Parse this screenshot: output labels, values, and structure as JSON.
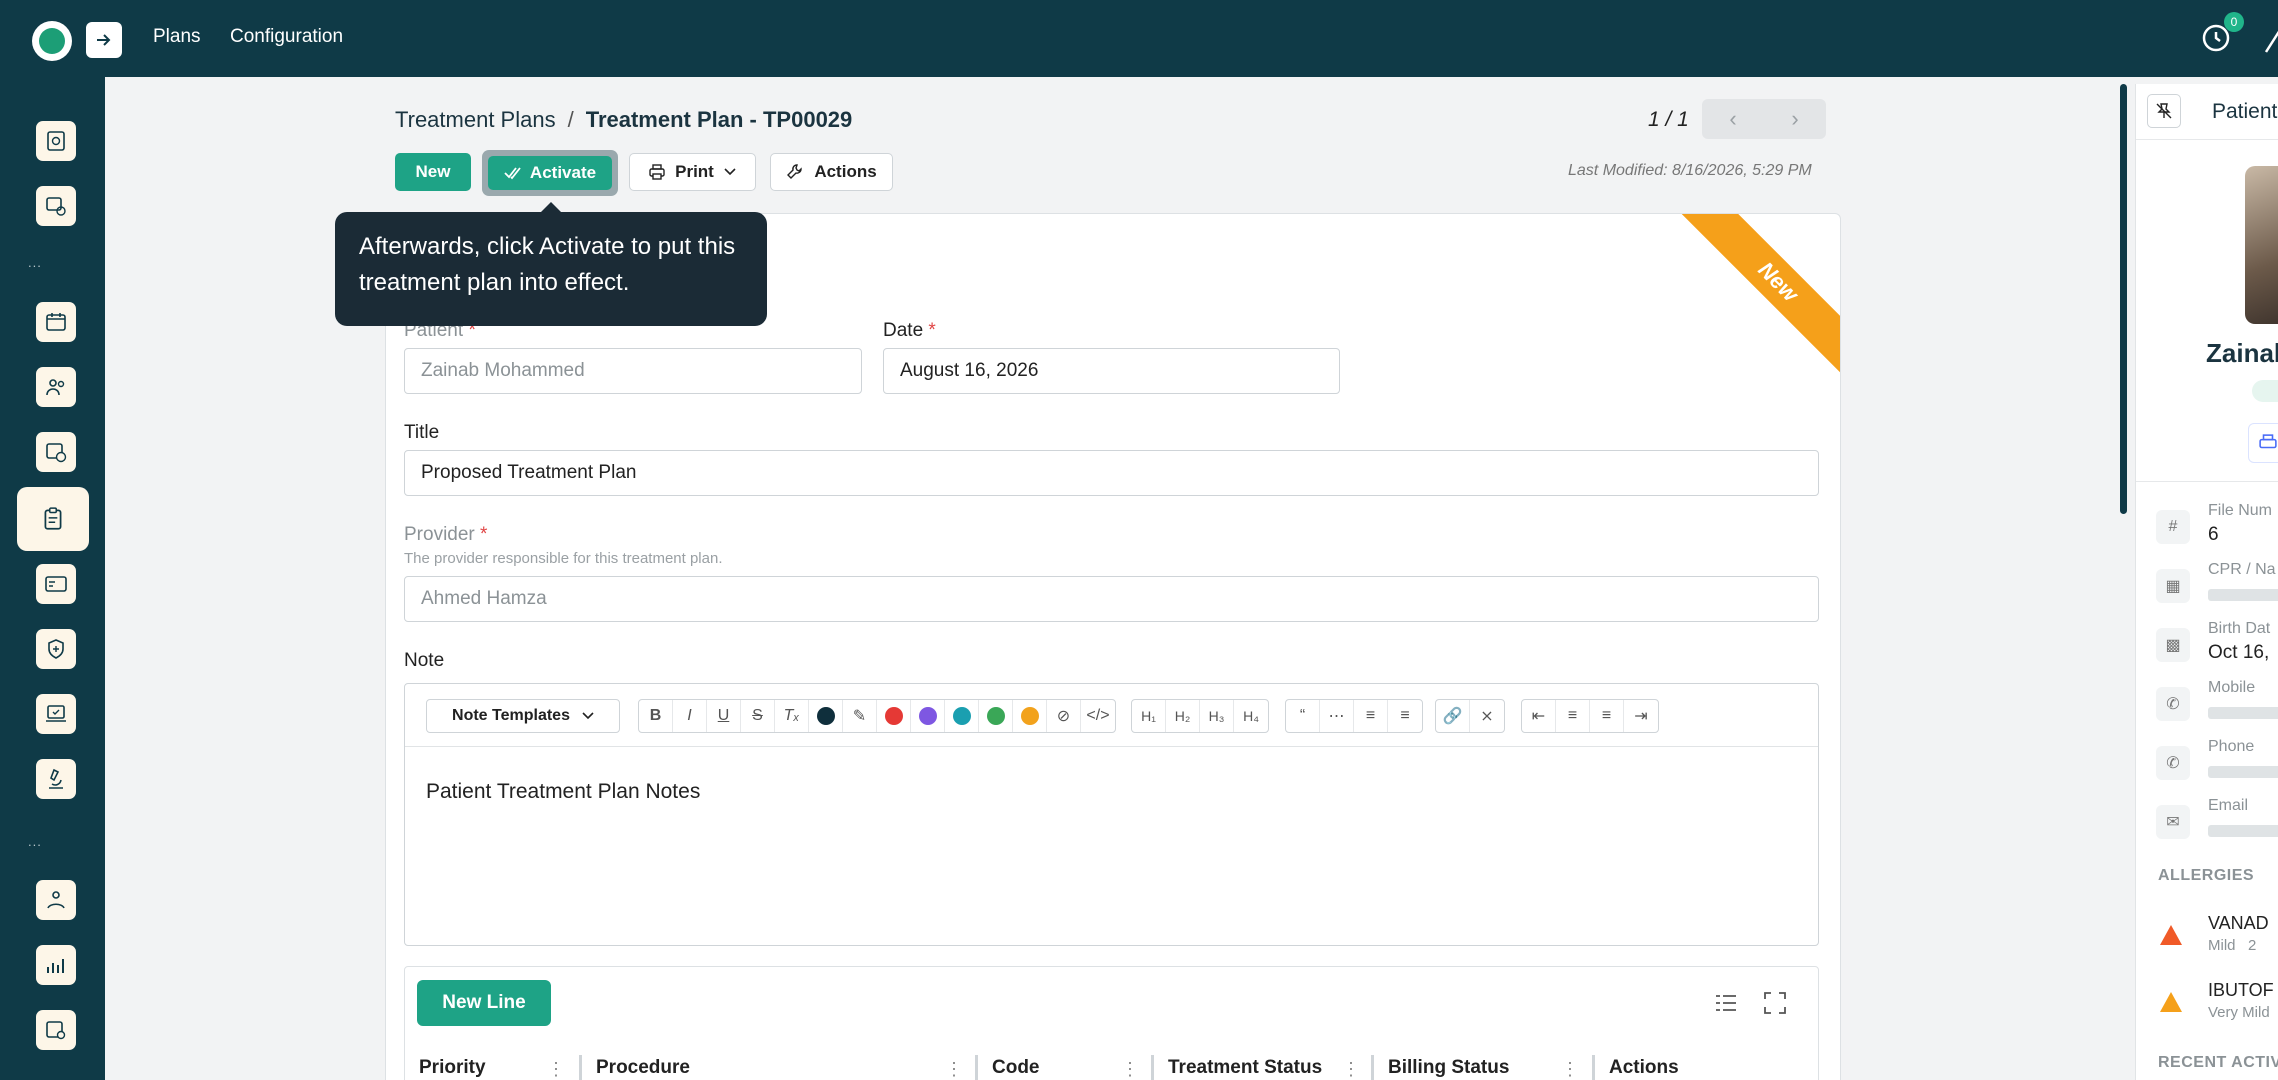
{
  "topbar": {
    "nav": [
      "Plans",
      "Configuration"
    ],
    "notification_count": "0"
  },
  "sidebar": {
    "dots": "...",
    "items": [
      {
        "icon": "tooth-chart-icon"
      },
      {
        "icon": "clinic-chart-icon"
      },
      {
        "icon": "calendar-icon"
      },
      {
        "icon": "staff-icon"
      },
      {
        "icon": "billing-clock-icon"
      },
      {
        "icon": "clipboard-icon"
      },
      {
        "icon": "insurance-card-icon"
      },
      {
        "icon": "care-shield-icon"
      },
      {
        "icon": "laptop-health-icon"
      },
      {
        "icon": "microscope-icon"
      },
      {
        "icon": "patient-care-icon"
      },
      {
        "icon": "analytics-icon"
      },
      {
        "icon": "settings-card-icon"
      }
    ]
  },
  "header": {
    "breadcrumb_parent": "Treatment Plans",
    "breadcrumb_sep": "/",
    "breadcrumb_current": "Treatment Plan - TP00029",
    "pager_text": "1 / 1",
    "last_modified": "Last Modified: 8/16/2026, 5:29 PM"
  },
  "toolbar": {
    "new_label": "New",
    "activate_label": "Activate",
    "print_label": "Print",
    "actions_label": "Actions"
  },
  "tooltip": {
    "text": "Afterwards, click Activate to put this treatment plan into effect."
  },
  "form": {
    "ribbon": "New",
    "patient_label": "Patient",
    "patient_value": "Zainab Mohammed",
    "date_label": "Date",
    "date_value": "August 16, 2026",
    "title_label": "Title",
    "title_value": "Proposed Treatment Plan",
    "provider_label": "Provider",
    "provider_help": "The provider responsible for this treatment plan.",
    "provider_value": "Ahmed Hamza",
    "note_label": "Note",
    "required_mark": "*"
  },
  "editor": {
    "templates_label": "Note Templates",
    "content": "Patient Treatment Plan Notes",
    "colors": [
      "#0f2f3c",
      "#e53935",
      "#7e57e2",
      "#1a9fb0",
      "#3aa757",
      "#f2a21c"
    ]
  },
  "lines": {
    "new_line_label": "New Line",
    "columns": [
      "Priority",
      "Procedure",
      "Code",
      "Treatment Status",
      "Billing Status",
      "Actions"
    ]
  },
  "patient_panel": {
    "title": "Patient",
    "name": "Zainab",
    "file_number_label": "File Num",
    "file_number_value": "6",
    "cpr_label": "CPR / Na",
    "birth_label": "Birth Dat",
    "birth_value": "Oct 16,",
    "mobile_label": "Mobile",
    "phone_label": "Phone",
    "email_label": "Email",
    "allergies_heading": "ALLERGIES",
    "allergies": [
      {
        "name": "VANAD",
        "severity": "Mild",
        "extra": "2",
        "color": "#f05a28"
      },
      {
        "name": "IBUTOF",
        "severity": "Very Mild",
        "extra": "",
        "color": "#f5a01a"
      }
    ],
    "recent_heading": "RECENT ACTIVI"
  }
}
